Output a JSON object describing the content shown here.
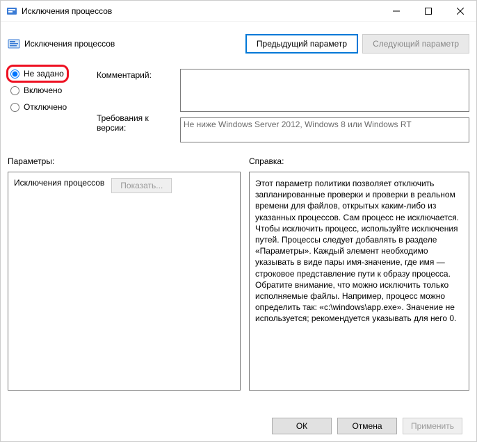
{
  "titlebar": {
    "title": "Исключения процессов"
  },
  "header": {
    "subtitle": "Исключения процессов",
    "prev_button": "Предыдущий параметр",
    "next_button": "Следующий параметр"
  },
  "state": {
    "options": {
      "not_configured": "Не задано",
      "enabled": "Включено",
      "disabled": "Отключено"
    },
    "selected": "not_configured"
  },
  "labels": {
    "comment": "Комментарий:",
    "supported": "Требования к версии:",
    "options_heading": "Параметры:",
    "help_heading": "Справка:"
  },
  "fields": {
    "comment_value": "",
    "supported_value": "Не ниже Windows Server 2012, Windows 8 или Windows RT"
  },
  "params_panel": {
    "item_label": "Исключения процессов",
    "show_button": "Показать..."
  },
  "help_text": "Этот параметр политики позволяет отключить запланированные проверки и проверки в реальном времени для файлов, открытых каким-либо из указанных процессов. Сам процесс не исключается. Чтобы исключить процесс, используйте исключения путей. Процессы следует добавлять в разделе «Параметры». Каждый элемент необходимо указывать в виде пары имя-значение, где имя — строковое представление пути к образу процесса. Обратите внимание, что можно исключить только исполняемые файлы. Например, процесс можно определить так: «c:\\windows\\app.exe». Значение не используется; рекомендуется указывать для него 0.",
  "footer": {
    "ok": "ОК",
    "cancel": "Отмена",
    "apply": "Применить"
  }
}
